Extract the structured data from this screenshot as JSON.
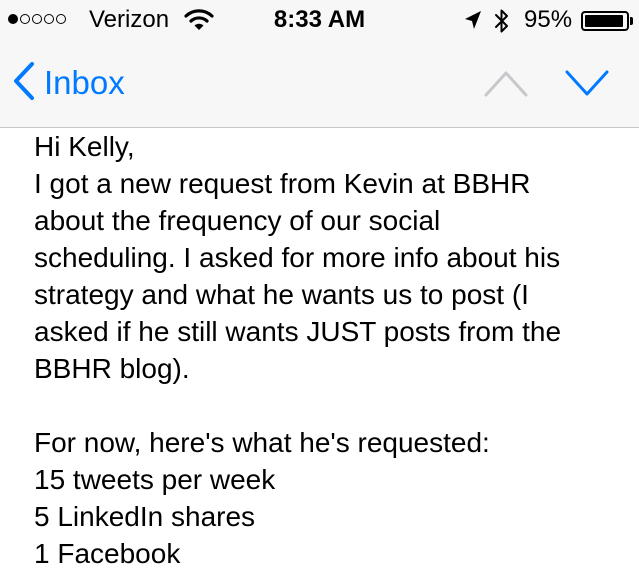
{
  "status_bar": {
    "carrier": "Verizon",
    "signal_bars_filled": 1,
    "signal_bars_total": 5,
    "time": "8:33 AM",
    "battery_percent": "95%",
    "battery_level": 0.95,
    "icons": [
      "wifi-icon",
      "location-arrow-icon",
      "bluetooth-icon",
      "battery-icon"
    ]
  },
  "nav": {
    "back_label": "Inbox",
    "accent_color": "#007aff",
    "previous_enabled": false,
    "next_enabled": true
  },
  "message": {
    "lines": [
      "Hi Kelly,",
      "I got a new request from Kevin at BBHR",
      "about the frequency of our social",
      "scheduling. I asked for more info about his",
      "strategy and what he wants us to post (I",
      "asked if he still wants JUST posts from the",
      "BBHR blog).",
      "",
      "For now, here's what he's requested:",
      "15 tweets per week",
      "5 LinkedIn shares",
      "1 Facebook"
    ]
  }
}
